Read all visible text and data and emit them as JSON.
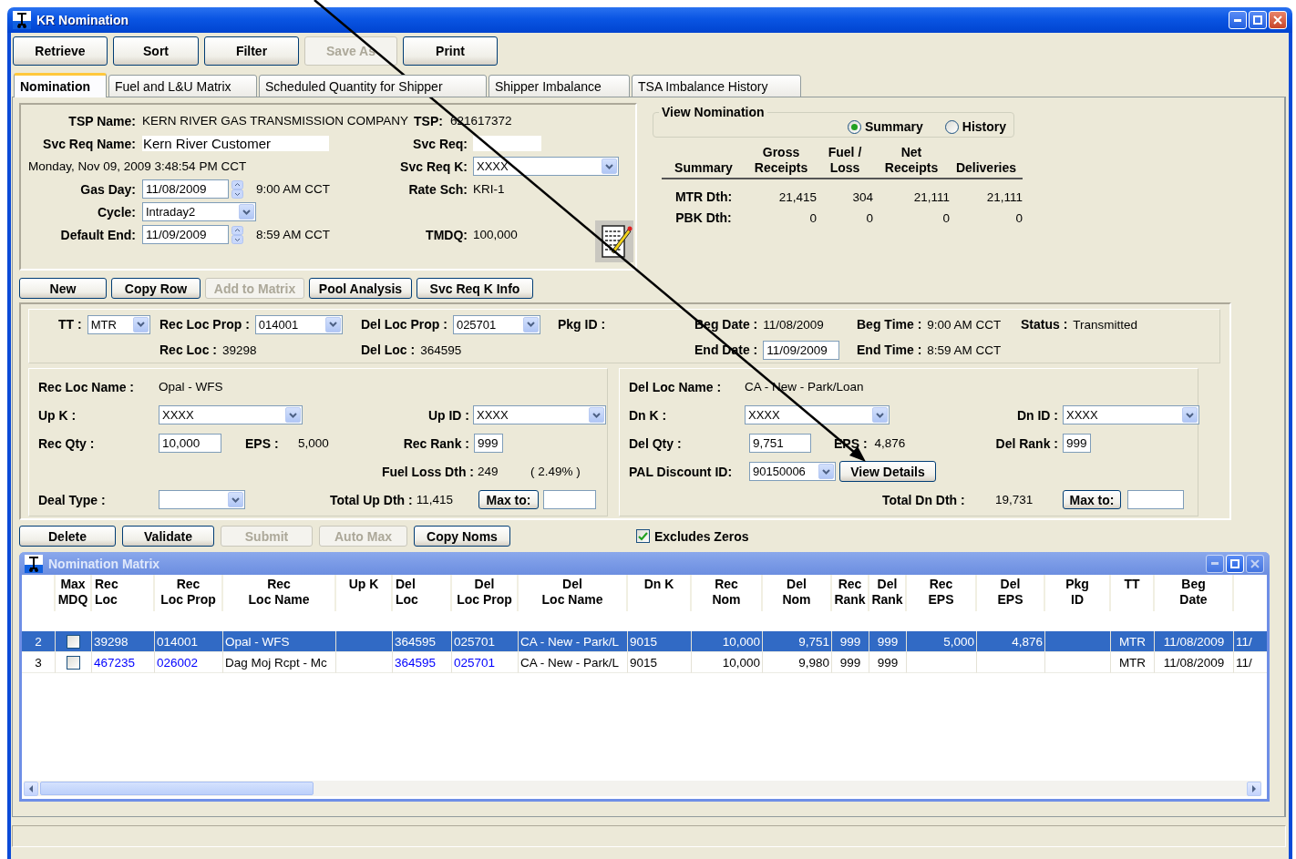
{
  "window": {
    "title": "KR Nomination"
  },
  "toolbar": [
    {
      "label": "Retrieve",
      "disabled": false
    },
    {
      "label": "Sort",
      "disabled": false
    },
    {
      "label": "Filter",
      "disabled": false
    },
    {
      "label": "Save As",
      "disabled": true
    },
    {
      "label": "Print",
      "disabled": false
    }
  ],
  "tabs": [
    {
      "label": "Nomination",
      "selected": true
    },
    {
      "label": "Fuel and L&U Matrix",
      "selected": false
    },
    {
      "label": "Scheduled Quantity for Shipper",
      "selected": false
    },
    {
      "label": "Shipper Imbalance",
      "selected": false
    },
    {
      "label": "TSA Imbalance History",
      "selected": false
    }
  ],
  "header": {
    "tsp_name": {
      "label": "TSP Name:",
      "value": "KERN RIVER GAS TRANSMISSION COMPANY"
    },
    "tsp": {
      "label": "TSP:",
      "value": "621617372"
    },
    "svc_req_name": {
      "label": "Svc Req Name:",
      "value": "Kern River Customer"
    },
    "svc_req": {
      "label": "Svc Req:"
    },
    "timestamp": "Monday, Nov 09, 2009 3:48:54 PM CCT",
    "svc_req_k": {
      "label": "Svc Req K:",
      "value": "XXXX"
    },
    "gas_day": {
      "label": "Gas Day:",
      "value": "11/08/2009",
      "time": "9:00 AM CCT"
    },
    "rate_sch": {
      "label": "Rate Sch:",
      "value": "KRI-1"
    },
    "cycle": {
      "label": "Cycle:",
      "value": "Intraday2"
    },
    "default_end": {
      "label": "Default End:",
      "value": "11/09/2009",
      "time": "8:59 AM CCT"
    },
    "tmdq": {
      "label": "TMDQ:",
      "value": "100,000"
    }
  },
  "view_nomination": {
    "title": "View Nomination",
    "options": [
      {
        "label": "Summary",
        "selected": true
      },
      {
        "label": "History",
        "selected": false
      }
    ],
    "columns": [
      "Summary",
      "Gross\nReceipts",
      "Fuel /\nLoss",
      "Net\nReceipts",
      "Deliveries"
    ],
    "rows": [
      {
        "label": "MTR Dth:",
        "values": [
          "21,415",
          "304",
          "21,111",
          "21,111"
        ]
      },
      {
        "label": "PBK Dth:",
        "values": [
          "0",
          "0",
          "0",
          "0"
        ]
      }
    ]
  },
  "actions": [
    {
      "label": "New",
      "disabled": false
    },
    {
      "label": "Copy Row",
      "disabled": false
    },
    {
      "label": "Add to Matrix",
      "disabled": true
    },
    {
      "label": "Pool Analysis",
      "disabled": false
    },
    {
      "label": "Svc Req K Info",
      "disabled": false
    }
  ],
  "detail": {
    "tt": {
      "label": "TT :",
      "value": "MTR"
    },
    "rec_loc_prop": {
      "label": "Rec Loc Prop :",
      "value": "014001"
    },
    "del_loc_prop": {
      "label": "Del Loc Prop :",
      "value": "025701"
    },
    "pkg_id": {
      "label": "Pkg ID :"
    },
    "beg_date": {
      "label": "Beg Date :",
      "value": "11/08/2009"
    },
    "beg_time": {
      "label": "Beg Time :",
      "value": "9:00 AM CCT"
    },
    "status": {
      "label": "Status :",
      "value": "Transmitted"
    },
    "rec_loc": {
      "label": "Rec Loc :",
      "value": "39298"
    },
    "del_loc": {
      "label": "Del Loc :",
      "value": "364595"
    },
    "end_date": {
      "label": "End Date :",
      "value": "11/09/2009"
    },
    "end_time": {
      "label": "End Time :",
      "value": "8:59 AM CCT"
    }
  },
  "receipt": {
    "rec_loc_name": {
      "label": "Rec Loc Name :",
      "value": "Opal - WFS"
    },
    "up_k": {
      "label": "Up K :",
      "value": "XXXX"
    },
    "up_id": {
      "label": "Up ID :",
      "value": "XXXX"
    },
    "rec_qty": {
      "label": "Rec Qty :",
      "value": "10,000"
    },
    "eps": {
      "label": "EPS :",
      "value": "5,000"
    },
    "rec_rank": {
      "label": "Rec Rank :",
      "value": "999"
    },
    "fuel_loss": {
      "label": "Fuel Loss Dth :",
      "value": "249",
      "percent": "( 2.49% )"
    },
    "deal_type": {
      "label": "Deal Type :"
    },
    "total_up": {
      "label": "Total Up Dth :",
      "value": "11,415"
    },
    "max_to": "Max to:"
  },
  "delivery": {
    "del_loc_name": {
      "label": "Del Loc Name :",
      "value": "CA - New - Park/Loan"
    },
    "dn_k": {
      "label": "Dn K :",
      "value": "XXXX"
    },
    "dn_id": {
      "label": "Dn ID :",
      "value": "XXXX"
    },
    "del_qty": {
      "label": "Del Qty :",
      "value": "9,751"
    },
    "eps": {
      "label": "EPS :",
      "value": "4,876"
    },
    "del_rank": {
      "label": "Del Rank :",
      "value": "999"
    },
    "pal_discount": {
      "label": "PAL Discount ID:",
      "value": "90150006"
    },
    "view_details": "View Details",
    "total_dn": {
      "label": "Total Dn Dth :",
      "value": "19,731"
    },
    "max_to": "Max to:"
  },
  "bottom_actions": [
    {
      "label": "Delete",
      "disabled": false
    },
    {
      "label": "Validate",
      "disabled": false
    },
    {
      "label": "Submit",
      "disabled": true
    },
    {
      "label": "Auto Max",
      "disabled": true
    },
    {
      "label": "Copy Noms",
      "disabled": false
    }
  ],
  "excludes_zeros": {
    "label": "Excludes Zeros",
    "checked": true
  },
  "matrix": {
    "title": "Nomination Matrix",
    "max_mdq_label": "Max\nMDQ",
    "columns": [
      {
        "label": "Rec\nLoc",
        "link": true
      },
      {
        "label": "Rec\nLoc Prop",
        "link": true
      },
      {
        "label": "Rec\nLoc Name",
        "link": false
      },
      {
        "label": "Up K"
      },
      {
        "label": "Del\nLoc",
        "link": true
      },
      {
        "label": "Del\nLoc Prop",
        "link": true
      },
      {
        "label": "Del\nLoc Name",
        "link": false
      },
      {
        "label": "Dn K",
        "link": false
      },
      {
        "label": "Rec\nNom",
        "link": false
      },
      {
        "label": "Del\nNom",
        "link": false
      },
      {
        "label": "Rec\nRank",
        "link": false
      },
      {
        "label": "Del\nRank",
        "link": false
      },
      {
        "label": "Rec\nEPS"
      },
      {
        "label": "Del\nEPS"
      },
      {
        "label": "Pkg\nID"
      },
      {
        "label": "TT",
        "link": false
      },
      {
        "label": "Beg\nDate",
        "link": false
      },
      {
        "link": false
      }
    ],
    "rows": [
      {
        "number": "2",
        "selected": true,
        "max_mdq": false,
        "cells": [
          "39298",
          "014001",
          "Opal - WFS",
          null,
          "364595",
          "025701",
          "CA - New - Park/L",
          "9015",
          "10,000",
          "9,751",
          "999",
          "999",
          "5,000",
          "4,876",
          null,
          "MTR",
          "11/08/2009",
          "11/"
        ]
      },
      {
        "number": "3",
        "selected": false,
        "max_mdq": false,
        "cells": [
          "467235",
          "026002",
          "Dag Moj Rcpt - Mc",
          null,
          "364595",
          "025701",
          "CA - New - Park/L",
          "9015",
          "10,000",
          "9,980",
          "999",
          "999",
          null,
          null,
          null,
          "MTR",
          "11/08/2009",
          "11/"
        ]
      }
    ]
  }
}
